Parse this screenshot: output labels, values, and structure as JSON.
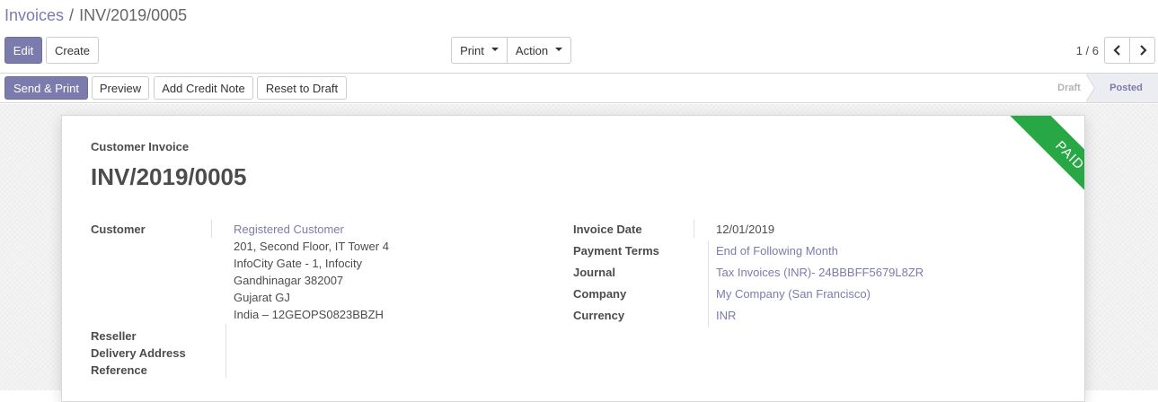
{
  "breadcrumb": {
    "parent": "Invoices",
    "separator": "/",
    "current": "INV/2019/0005"
  },
  "toolbar": {
    "edit_label": "Edit",
    "create_label": "Create",
    "print_label": "Print",
    "action_label": "Action"
  },
  "pager": {
    "value": "1 / 6"
  },
  "statusbar": {
    "buttons": [
      "Send & Print",
      "Preview",
      "Add Credit Note",
      "Reset to Draft"
    ],
    "stages": [
      "Draft",
      "Posted"
    ],
    "active_stage": "Posted"
  },
  "invoice": {
    "type": "Customer Invoice",
    "name": "INV/2019/0005",
    "ribbon": "PAID",
    "left": {
      "customer_label": "Customer",
      "customer_name": "Registered Customer",
      "address_lines": [
        "201, Second Floor, IT Tower 4",
        "InfoCity Gate - 1, Infocity",
        "Gandhinagar 382007",
        "Gujarat GJ",
        "India – 12GEOPS0823BBZH"
      ],
      "reseller_label": "Reseller",
      "delivery_label": "Delivery Address",
      "reference_label": "Reference"
    },
    "right": [
      {
        "label": "Invoice Date",
        "value": "12/01/2019",
        "link": false
      },
      {
        "label": "Payment Terms",
        "value": "End of Following Month",
        "link": true
      },
      {
        "label": "Journal",
        "value": "Tax Invoices (INR)- 24BBBFF5679L8ZR",
        "link": true
      },
      {
        "label": "Company",
        "value": "My Company (San Francisco)",
        "link": true
      },
      {
        "label": "Currency",
        "value": "INR",
        "link": true
      }
    ]
  },
  "colors": {
    "primary": "#7c7bad",
    "paid_ribbon": "#28a745",
    "text": "#4c4c4c"
  }
}
